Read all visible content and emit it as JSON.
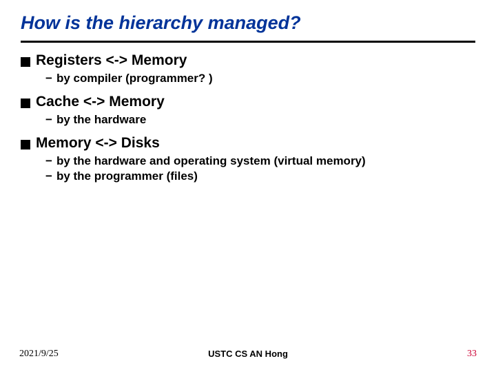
{
  "title": "How is the hierarchy managed?",
  "items": [
    {
      "main": "Registers <-> Memory",
      "subs": [
        "by compiler (programmer? )"
      ]
    },
    {
      "main": "Cache <-> Memory",
      "subs": [
        "by the hardware"
      ]
    },
    {
      "main": "Memory <-> Disks",
      "subs": [
        "by the hardware and operating system (virtual memory)",
        "by the programmer (files)"
      ]
    }
  ],
  "footer": {
    "date": "2021/9/25",
    "center": "USTC CS AN Hong",
    "page": "33"
  }
}
